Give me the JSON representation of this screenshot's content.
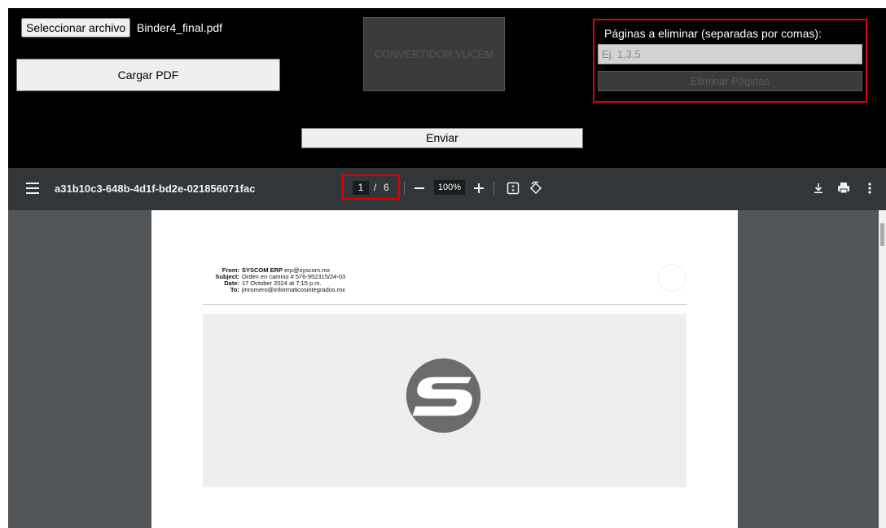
{
  "form": {
    "file_button": "Seleccionar archivo",
    "file_name": "Binder4_final.pdf",
    "load_pdf": "Cargar PDF",
    "vucem_button": "CONVERTIDOR VUCEM",
    "delete_label": "Páginas a eliminar (separadas por comas):",
    "delete_placeholder": "Ej. 1,3,5",
    "delete_button": "Eliminar Páginas",
    "send_button": "Enviar"
  },
  "viewer": {
    "title": "a31b10c3-648b-4d1f-bd2e-021856071fac",
    "page_current": "1",
    "page_sep": "/",
    "page_total": "6",
    "zoom": "100%",
    "icons": [
      "menu-icon",
      "zoom-out-icon",
      "zoom-in-icon",
      "fit-page-icon",
      "rotate-icon",
      "download-icon",
      "print-icon",
      "more-icon"
    ]
  },
  "email": {
    "from_key": "From:",
    "from_name": "SYSCOM ERP",
    "from_email": "erp@syscom.mx",
    "subject_key": "Subject:",
    "subject": "Orden en camino # 576-952315/24-03",
    "date_key": "Date:",
    "date": "17 October 2024 at 7:15 p.m.",
    "to_key": "To:",
    "to": "jmromero@informaticosintegrados.mx"
  },
  "colors": {
    "highlight": "#e00000",
    "toolbar": "#323639",
    "viewer_bg": "#525659",
    "logo": "#6b6b6b"
  }
}
